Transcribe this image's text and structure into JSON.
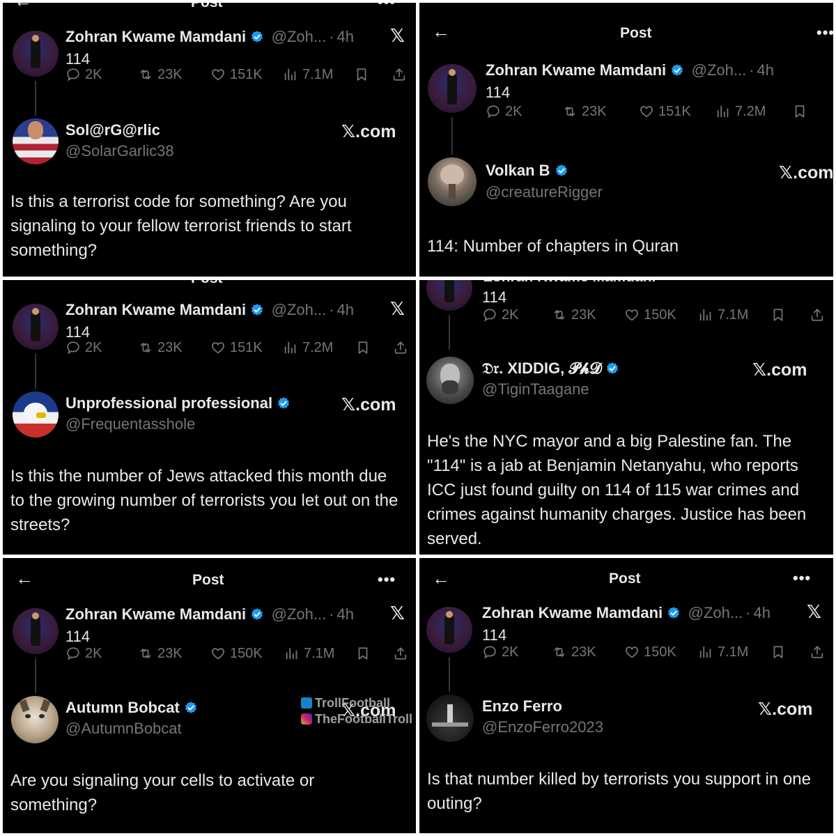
{
  "header": {
    "title": "Post",
    "back_icon": "arrow-left-icon",
    "more": "•••"
  },
  "original": {
    "name": "Zohran Kwame Mamdani",
    "handle": "@Zoh...",
    "sep": "·",
    "time": "4h",
    "text": "114",
    "x_logo": "𝕏"
  },
  "panels": [
    {
      "stats": {
        "replies": "2K",
        "reposts": "23K",
        "likes": "151K",
        "views": "7.1M"
      },
      "reply": {
        "name": "Sol@rG@rlic",
        "handle": "@SolarGarlic38",
        "verified": false,
        "source": "𝕏.com",
        "text": "Is this a terrorist code for something? Are you signaling to your fellow terrorist friends to start something?"
      }
    },
    {
      "stats": {
        "replies": "2K",
        "reposts": "23K",
        "likes": "151K",
        "views": "7.2M"
      },
      "reply": {
        "name": "Volkan B",
        "handle": "@creatureRigger",
        "verified": true,
        "source": "𝕏.com",
        "text": "114: Number of chapters in Quran"
      }
    },
    {
      "stats": {
        "replies": "2K",
        "reposts": "23K",
        "likes": "151K",
        "views": "7.2M"
      },
      "reply": {
        "name": "Unprofessional professional",
        "handle": "@Frequentasshole",
        "verified": true,
        "source": "𝕏.com",
        "text": "Is this the number of Jews attacked this month due to the growing number of terrorists you let out on the streets?"
      }
    },
    {
      "stats": {
        "replies": "2K",
        "reposts": "23K",
        "likes": "150K",
        "views": "7.1M"
      },
      "reply": {
        "name": "𝔇𝔯. XIDDIG, 𝓟𝓱𝓓",
        "handle": "@TiginTaagane",
        "verified": true,
        "source": "𝕏.com",
        "text": "He's the NYC mayor and a big Palestine fan. The \"114\" is a jab at Benjamin Netanyahu, who reports ICC just found guilty on 114 of 115 war crimes and crimes against humanity charges. Justice has been served."
      }
    },
    {
      "stats": {
        "replies": "2K",
        "reposts": "23K",
        "likes": "150K",
        "views": "7.1M"
      },
      "reply": {
        "name": "Autumn Bobcat",
        "handle": "@AutumnBobcat",
        "verified": true,
        "source": "𝕏.com",
        "text": "Are you signaling your cells to activate or something?"
      }
    },
    {
      "stats": {
        "replies": "2K",
        "reposts": "23K",
        "likes": "150K",
        "views": "7.1M"
      },
      "reply": {
        "name": "Enzo Ferro",
        "handle": "@EnzoFerro2023",
        "verified": false,
        "source": "𝕏.com",
        "text": "Is that number killed by terrorists you support in one outing?"
      }
    }
  ],
  "watermark": {
    "line1": "TrollFootball",
    "line2": "TheFootballTroll"
  },
  "colors": {
    "background": "#000000",
    "text": "#e7e9ea",
    "muted": "#71767b",
    "verified": "#1d9bf0",
    "border": "#333639"
  }
}
